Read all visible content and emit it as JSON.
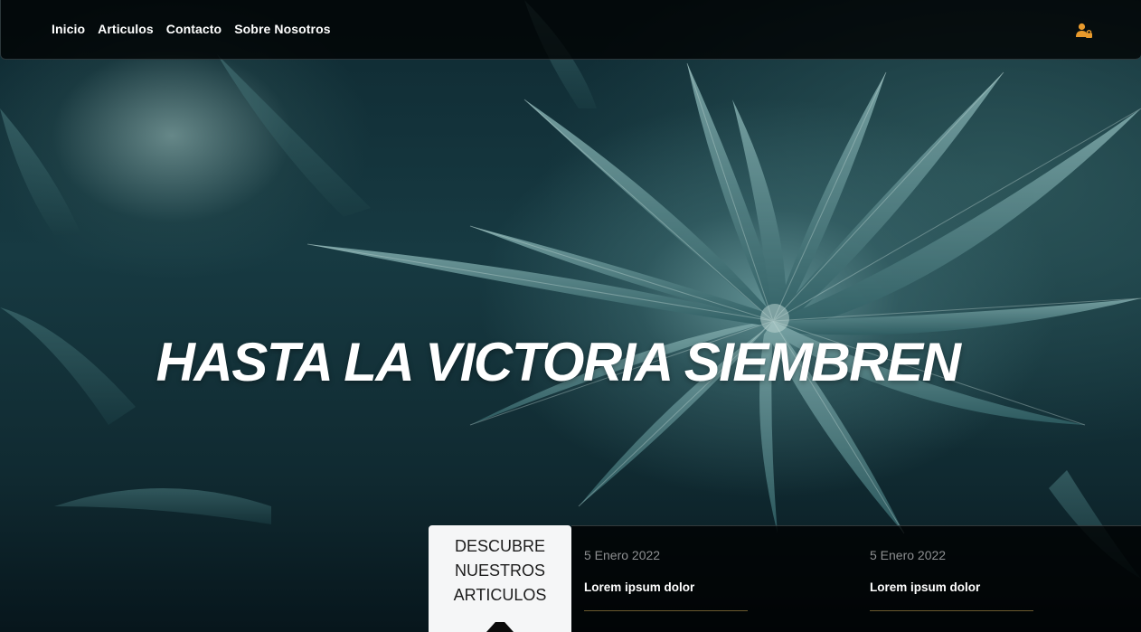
{
  "nav": {
    "links": [
      "Inicio",
      "Articulos",
      "Contacto",
      "Sobre Nosotros"
    ],
    "user_icon": "user-lock-icon"
  },
  "hero": {
    "headline": "HASTA LA VICTORIA SIEMBREN"
  },
  "discover": {
    "label": "DESCUBRE\nNUESTROS\nARTICULOS"
  },
  "articles": [
    {
      "date": "5 Enero 2022",
      "title": "Lorem ipsum dolor"
    },
    {
      "date": "5 Enero 2022",
      "title": "Lorem ipsum dolor"
    }
  ],
  "colors": {
    "accent": "#e89a2c",
    "article_rule": "#6b5a2e",
    "card_bg": "#f5f6f7"
  }
}
